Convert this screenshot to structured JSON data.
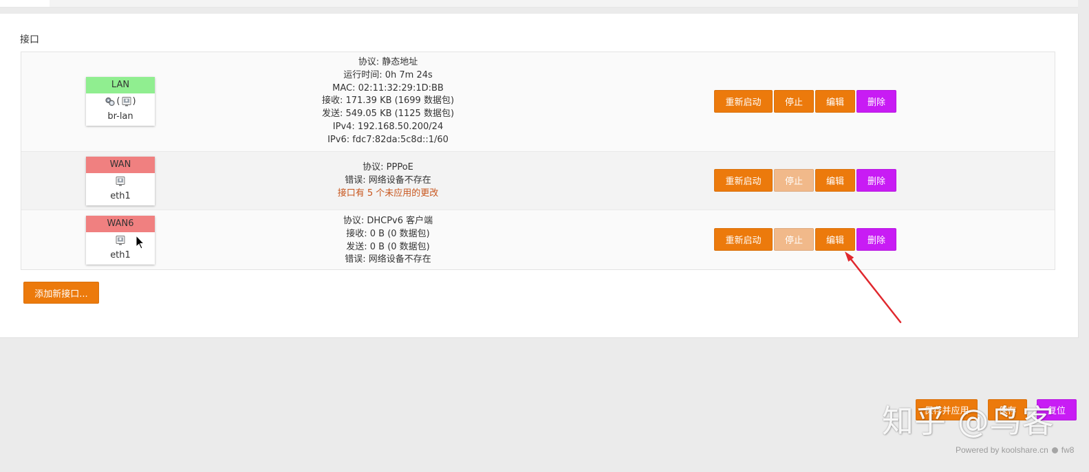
{
  "colors": {
    "accent": "#ec7a0c",
    "accent_disabled": "#f1b98a",
    "danger": "#c81cf4",
    "warning_text": "#c8561d",
    "annotation": "#e0282e"
  },
  "section_title": "接口",
  "row_actions": {
    "restart": "重新启动",
    "stop": "停止",
    "edit": "编辑",
    "delete": "删除"
  },
  "interfaces": [
    {
      "name": "LAN",
      "header_color": "#90ee90",
      "icons": [
        "bridge-icon",
        "ethernet-port-icon"
      ],
      "icon_group_open": "(",
      "icon_group_close": ")",
      "device": "br-lan",
      "info": [
        "协议: 静态地址",
        "运行时间: 0h 7m 24s",
        "MAC: 02:11:32:29:1D:BB",
        "接收: 171.39 KB (1699 数据包)",
        "发送: 549.05 KB (1125 数据包)",
        "IPv4: 192.168.50.200/24",
        "IPv6: fdc7:82da:5c8d::1/60"
      ],
      "stop_enabled": true
    },
    {
      "name": "WAN",
      "header_color": "#f08080",
      "icons": [
        "ethernet-port-icon"
      ],
      "device": "eth1",
      "info": [
        "协议: PPPoE",
        "错误: 网络设备不存在"
      ],
      "warning": "接口有 5 个未应用的更改",
      "stop_enabled": false
    },
    {
      "name": "WAN6",
      "header_color": "#f08080",
      "icons": [
        "ethernet-port-icon"
      ],
      "device": "eth1",
      "info": [
        "协议: DHCPv6 客户端",
        "接收: 0 B (0 数据包)",
        "发送: 0 B (0 数据包)",
        "错误: 网络设备不存在"
      ],
      "stop_enabled": false
    }
  ],
  "add_interface_button": "添加新接口...",
  "footer_actions": {
    "save_apply": "保存并应用",
    "save": "保存",
    "reset": "复位"
  },
  "watermark": "知乎 @鸟客",
  "powered_by": {
    "text": "Powered by koolshare.cn",
    "status_icon": "dot-icon",
    "firmware": "fw8"
  }
}
